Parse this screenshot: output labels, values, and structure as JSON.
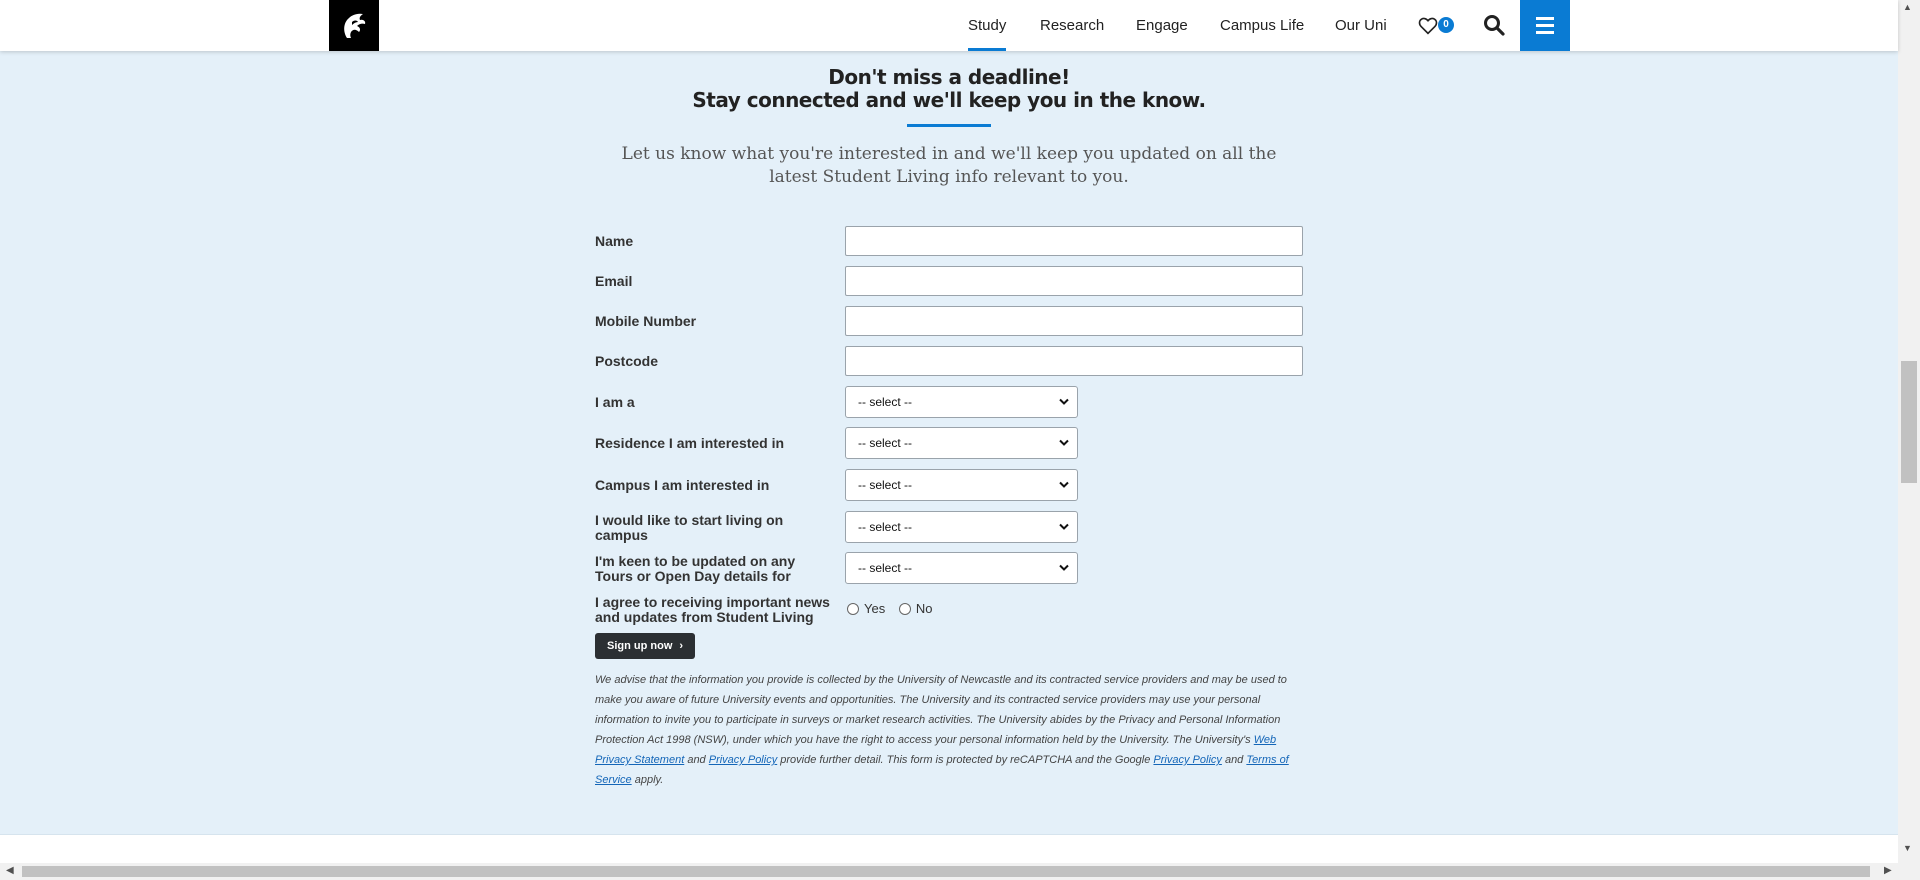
{
  "header": {
    "nav": [
      {
        "label": "Study",
        "active": true
      },
      {
        "label": "Research",
        "active": false
      },
      {
        "label": "Engage",
        "active": false
      },
      {
        "label": "Campus Life",
        "active": false
      },
      {
        "label": "Our Uni",
        "active": false
      }
    ],
    "favourites_count": "0",
    "accent": "#0a7bd3"
  },
  "form_section": {
    "heading_line1": "Don't miss a deadline!",
    "heading_line2": "Stay connected and we'll keep you in the know.",
    "intro": "Let us know what you're interested in and we'll keep you updated on all the latest Student Living info relevant to you.",
    "fields": {
      "name": {
        "label": "Name",
        "value": ""
      },
      "email": {
        "label": "Email",
        "value": ""
      },
      "mobile": {
        "label": "Mobile Number",
        "value": ""
      },
      "postcode": {
        "label": "Postcode",
        "value": ""
      },
      "i_am_a": {
        "label": "I am a",
        "value": "-- select --"
      },
      "residence": {
        "label": "Residence I am interested in",
        "value": "-- select --"
      },
      "campus": {
        "label": "Campus I am interested in",
        "value": "-- select --"
      },
      "start_living": {
        "label": "I would like to start living on campus",
        "value": "-- select --"
      },
      "tours": {
        "label": "I'm keen to be updated on any Tours or Open Day details for",
        "value": "-- select --"
      },
      "agree": {
        "label": "I agree to receiving important news and updates from Student Living",
        "options": [
          "Yes",
          "No"
        ]
      }
    },
    "submit_label": "Sign up now",
    "disclaimer": {
      "part1": "We advise that the information you provide is collected by the University of Newcastle and its contracted service providers and may be used to make you aware of future University events and opportunities. The University and its contracted service providers may use your personal information to invite you to participate in surveys or market research activities. The University abides by the Privacy and Personal Information Protection Act 1998 (NSW), under which you have the right to access your personal information held by the University. The University's ",
      "link1": "Web Privacy Statement",
      "and1": " and ",
      "link2": "Privacy Policy",
      "part2": " provide further detail. This form is protected by reCAPTCHA and the Google ",
      "link3": "Privacy Policy",
      "and2": " and ",
      "link4": "Terms of Service",
      "part3": " apply."
    }
  }
}
